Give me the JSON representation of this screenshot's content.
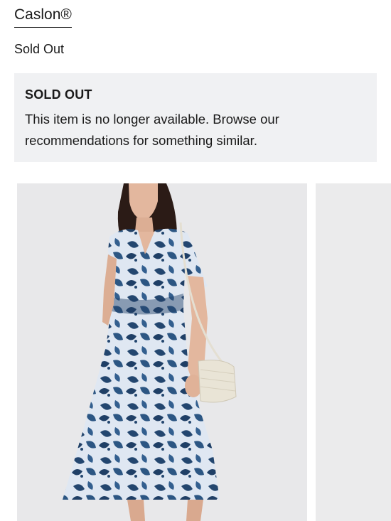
{
  "brand": {
    "name": "Caslon®"
  },
  "availability": {
    "status": "Sold Out"
  },
  "sold_out_notice": {
    "title": "SOLD OUT",
    "message": "This item is no longer available. Browse our recommendations for something similar."
  },
  "gallery": {
    "images": [
      {
        "subject": "model wearing blue and white floral print midi wrap dress with woven crossbody bag"
      },
      {
        "subject": "next product image (partially visible)"
      }
    ]
  },
  "colors": {
    "notice_background": "#f0f1f3",
    "text": "#1a1a1a",
    "dress_navy": "#23466f",
    "dress_light": "#dfe7f2"
  }
}
